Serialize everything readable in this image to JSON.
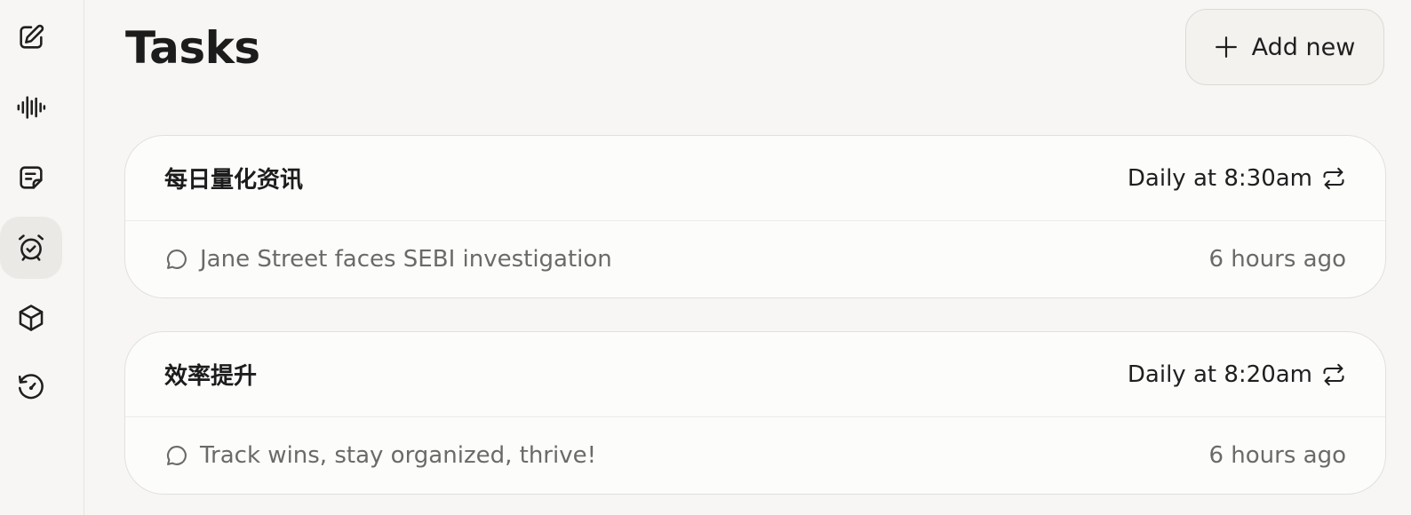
{
  "sidebar": {
    "items": [
      {
        "icon": "edit-icon"
      },
      {
        "icon": "voice-waveform-icon"
      },
      {
        "icon": "note-icon"
      },
      {
        "icon": "alarm-clock-icon",
        "active": true
      },
      {
        "icon": "cube-icon"
      },
      {
        "icon": "history-icon"
      }
    ]
  },
  "header": {
    "title": "Tasks",
    "add_label": "Add new",
    "add_icon": "plus-icon"
  },
  "tasks": [
    {
      "title": "每日量化资讯",
      "schedule": "Daily at 8:30am",
      "last_message": "Jane Street faces SEBI investigation",
      "time_ago": "6 hours ago"
    },
    {
      "title": "效率提升",
      "schedule": "Daily at 8:20am",
      "last_message": "Track wins, stay organized, thrive!",
      "time_ago": "6 hours ago"
    }
  ],
  "colors": {
    "background": "#f7f6f4",
    "card": "#fcfcfb",
    "active_nav": "#ebe9e6",
    "muted_text": "#6b6a68"
  }
}
